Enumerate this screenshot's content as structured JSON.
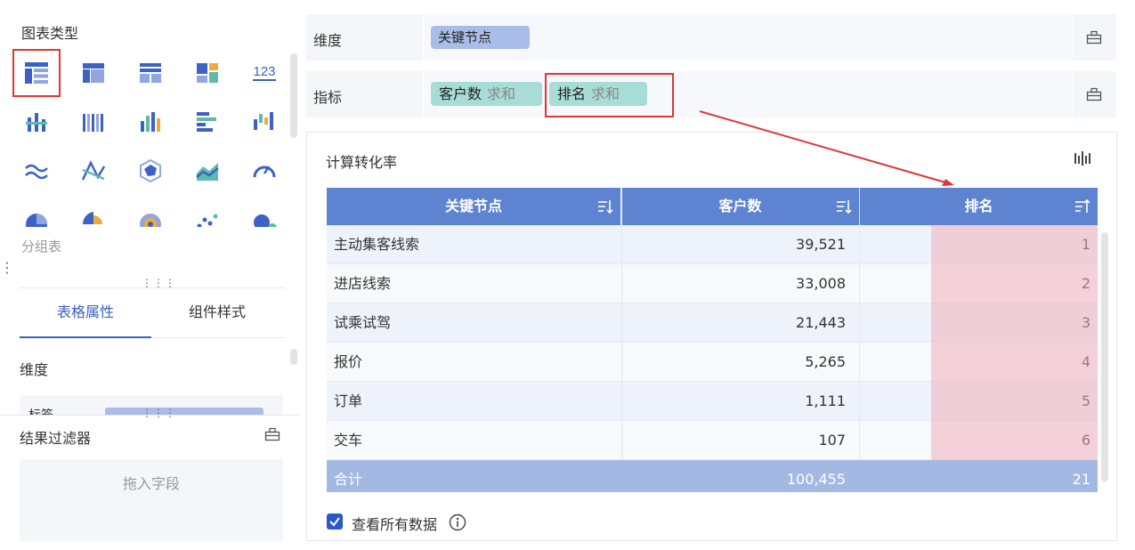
{
  "left_panel": {
    "section_title": "图表类型",
    "chart_type_name": "分组表",
    "tabs": [
      "表格属性",
      "组件样式"
    ],
    "dimension_label": "维度",
    "dimension_field_partial": "标签",
    "filter_title": "结果过滤器",
    "drop_hint": "拖入字段",
    "chart_icons": [
      "grouped-table-icon",
      "crosstab-icon",
      "detail-table-icon",
      "treemap-icon",
      "kpi-number-icon",
      "stacked-column-icon",
      "multi-column-icon",
      "column-icon",
      "bar-icon",
      "waterfall-icon",
      "area-line-icon",
      "line-icon",
      "radar-icon",
      "area-icon",
      "gauge-icon",
      "pie-icon",
      "rose-pie-icon",
      "sunburst-icon",
      "scatter-icon",
      "bubble-icon"
    ],
    "kpi_icon_text": "123"
  },
  "dimension_row": {
    "label": "维度",
    "pill": "关键节点"
  },
  "metric_row": {
    "label": "指标",
    "pills": [
      {
        "name": "客户数",
        "agg": "求和"
      },
      {
        "name": "排名",
        "agg": "求和"
      }
    ]
  },
  "card": {
    "title": "计算转化率",
    "columns": [
      "关键节点",
      "客户数",
      "排名"
    ],
    "rows": [
      {
        "node": "主动集客线索",
        "count": "39,521",
        "rank": "1"
      },
      {
        "node": "进店线索",
        "count": "33,008",
        "rank": "2"
      },
      {
        "node": "试乘试驾",
        "count": "21,443",
        "rank": "3"
      },
      {
        "node": "报价",
        "count": "5,265",
        "rank": "4"
      },
      {
        "node": "订单",
        "count": "1,111",
        "rank": "5"
      },
      {
        "node": "交车",
        "count": "107",
        "rank": "6"
      }
    ],
    "total": {
      "label": "合计",
      "count": "100,455",
      "rank": "21"
    },
    "show_all_label": "查看所有数据",
    "show_all_checked": true
  },
  "colors": {
    "accent": "#3a5fbf",
    "header": "#5d83d1",
    "highlight": "#e03636",
    "rank_bg": "#f4cdd3"
  }
}
